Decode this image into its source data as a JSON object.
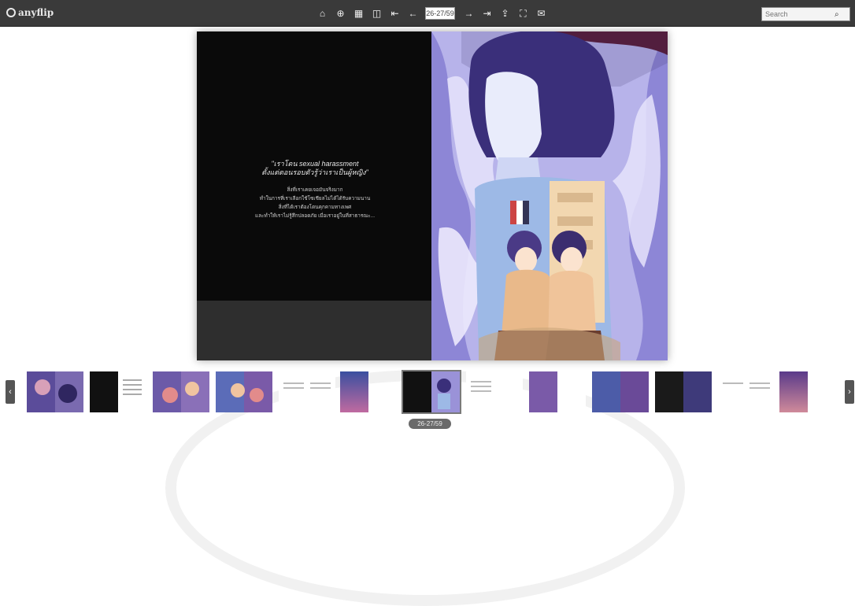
{
  "topbar": {
    "logo_text": "anyflip",
    "tools": [
      {
        "name": "home-icon",
        "glyph": "⌂"
      },
      {
        "name": "zoom-icon",
        "glyph": "⊕"
      },
      {
        "name": "thumbnails-icon",
        "glyph": "▦"
      },
      {
        "name": "single-page-icon",
        "glyph": "◫"
      },
      {
        "name": "first-page-icon",
        "glyph": "⇤"
      },
      {
        "name": "previous-page-icon",
        "glyph": "←"
      }
    ],
    "page_value": "26-27/59",
    "tools_after": [
      {
        "name": "next-page-icon",
        "glyph": "→"
      },
      {
        "name": "last-page-icon",
        "glyph": "⇥"
      },
      {
        "name": "share-icon",
        "glyph": "⇪"
      },
      {
        "name": "fullscreen-icon",
        "glyph": "⛶"
      },
      {
        "name": "email-icon",
        "glyph": "✉"
      }
    ],
    "search_placeholder": "Search",
    "search_icon": "⌕"
  },
  "book": {
    "quote_line1": "\"เราโดน sexual harassment",
    "quote_line2": "ตั้งแต่ตอนรอบตัวรู้ว่าเราเป็นผู้หญิง\"",
    "body_lines": [
      "สิ่งที่เราเคยเจอมันจริงมาก",
      "ทำในการที่เราเลือกใช้โซเชียลไม่ได้ได้รับความนาน",
      "สิ่งที่ได้เราต้องโดนคุกคามทางเพศ",
      "และทำให้เราไม่รู้สึกปลอดภัย เมื่อเราอยู่ในที่สาธารณะ..."
    ]
  },
  "nav": {
    "prev_glyph": "‹",
    "next_glyph": "›"
  },
  "thumbnail_strip": {
    "page_indicator": "26-27/59"
  },
  "colors": {
    "topbar": "#3a3a3a",
    "accent": "#5a54a8"
  }
}
